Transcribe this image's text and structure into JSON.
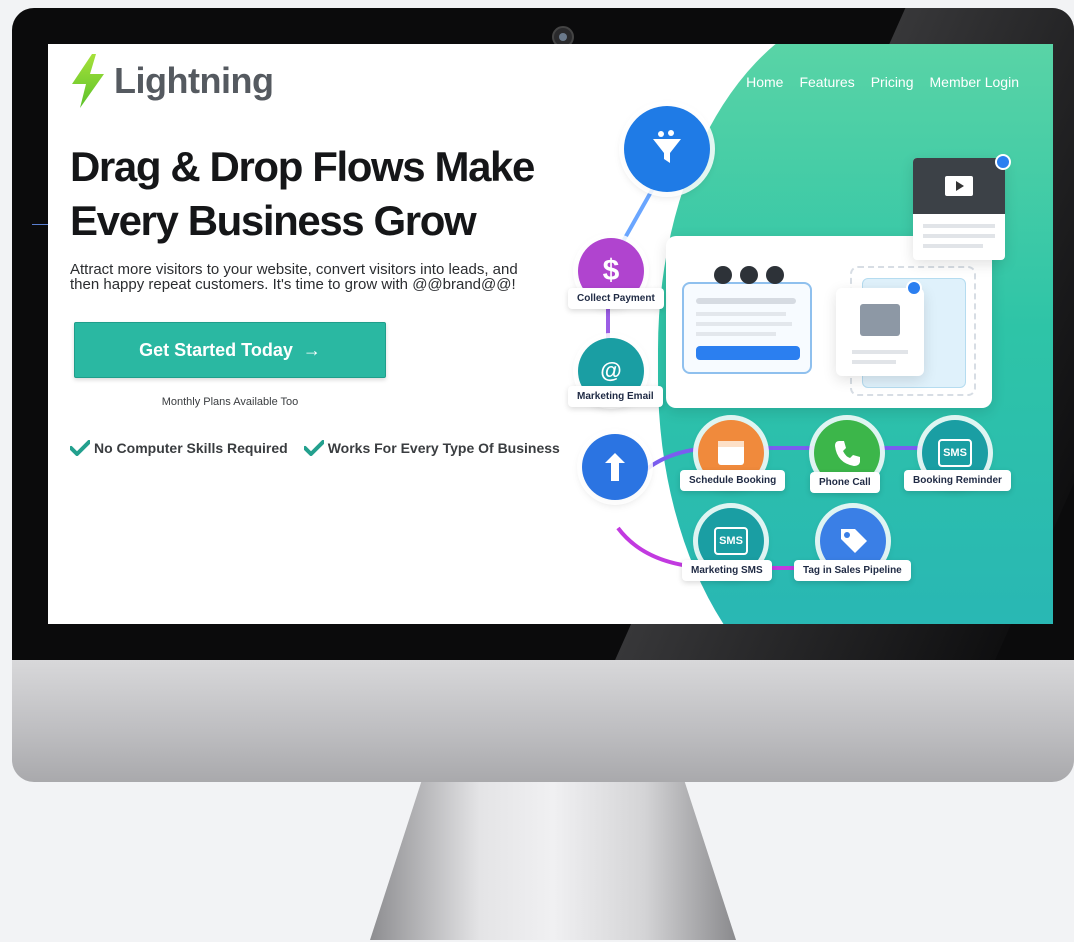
{
  "brand": {
    "name": "Lightning",
    "accent": "#2ab8a2",
    "bolt_color": "#8bd32a"
  },
  "nav": {
    "items": [
      "Home",
      "Features",
      "Pricing",
      "Member Login"
    ]
  },
  "hero": {
    "title_line1": "Drag & Drop Flows Make",
    "title_line2": "Every Business Grow",
    "subtitle": "Attract more visitors to your website, convert visitors into leads, and then happy repeat customers. It's time to grow with @@brand@@!",
    "cta_label": "Get Started Today",
    "cta_arrow": "→",
    "note": "Monthly Plans Available Too",
    "checks": [
      "No Computer Skills Required",
      "Works For Every Type Of Business"
    ]
  },
  "flow": {
    "nodes": {
      "collect_payment": "Collect Payment",
      "marketing_email": "Marketing Email",
      "schedule_booking": "Schedule Booking",
      "phone_call": "Phone Call",
      "booking_reminder": "Booking Reminder",
      "marketing_sms": "Marketing SMS",
      "tag_pipeline": "Tag in Sales Pipeline"
    },
    "dollar_glyph": "$",
    "at_glyph": "@",
    "sms_glyph": "SMS"
  }
}
